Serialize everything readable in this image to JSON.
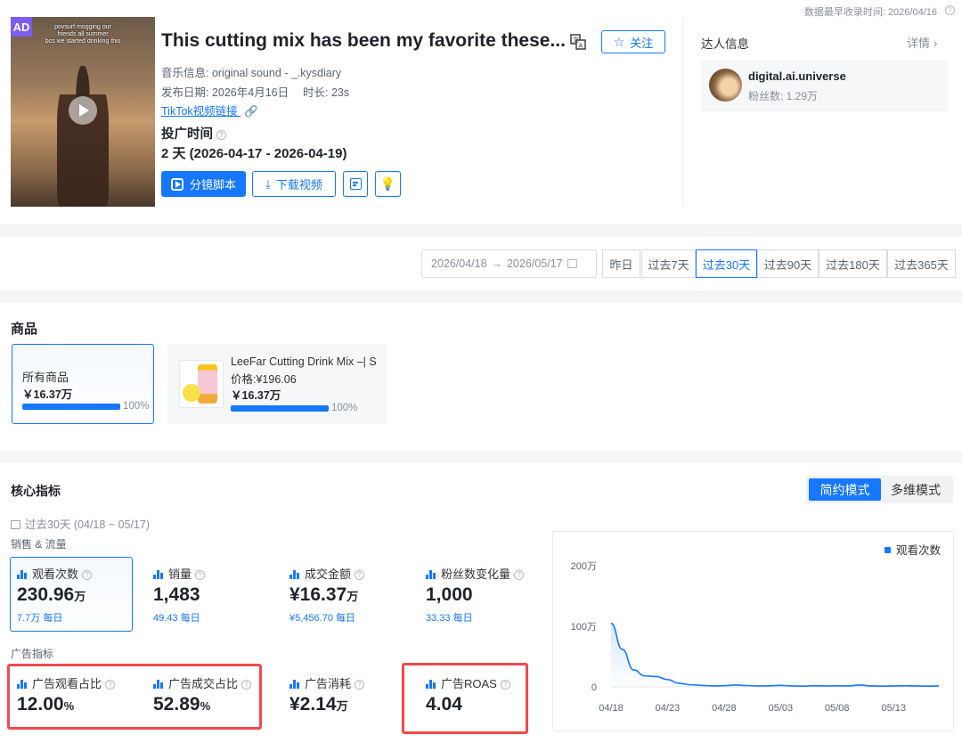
{
  "header": {
    "data_collected": "数据最早收录时间: 2026/04/16",
    "video": {
      "ad_badge": "AD",
      "caption_line1": "povsurf mogging our",
      "caption_line2": "friends all summer",
      "caption_line3": "bcs we started drinking this",
      "title": "This cutting mix has been my favorite these...",
      "follow_label": "关注",
      "music": "音乐信息: original sound - _.kysdiary",
      "publish_date": "发布日期: 2026年4月16日",
      "duration": "时长: 23s",
      "link": "TikTok视频链接",
      "ad_time_label": "投广时间",
      "ad_time_value": "2 天 (2026-04-17 - 2026-04-19)",
      "script_button": "分镜脚本",
      "download_button": "下载视频"
    },
    "influencer": {
      "section_title": "达人信息",
      "detail_link": "详情",
      "name": "digital.ai.universe",
      "fans": "粉丝数: 1.29万"
    }
  },
  "date_filter": {
    "start": "2026/04/18",
    "end": "2026/05/17",
    "ranges": [
      "昨日",
      "过去7天",
      "过去30天",
      "过去90天",
      "过去180天",
      "过去365天"
    ],
    "active_index": 2
  },
  "products": {
    "section_title": "商品",
    "all": {
      "label": "所有商品",
      "amount": "￥16.37万",
      "percent": "100%",
      "fill": 1.0
    },
    "item": {
      "name": "LeeFar Cutting Drink Mix –| S",
      "price": "价格:¥196.06",
      "amount": "￥16.37万",
      "percent": "100%",
      "fill": 1.0
    }
  },
  "core": {
    "section_title": "核心指标",
    "modes": [
      "简约模式",
      "多维模式"
    ],
    "period": "过去30天 (04/18 ~ 05/17)",
    "sales_group": "销售 & 流量",
    "ads_group": "广告指标",
    "metrics": [
      {
        "label": "观看次数",
        "value": "230.96",
        "unit": "万",
        "sub": "7.7万 每日"
      },
      {
        "label": "销量",
        "value": "1,483",
        "unit": "",
        "sub": "49.43 每日"
      },
      {
        "label": "成交金额",
        "value": "¥16.37",
        "unit": "万",
        "sub": "¥5,456.70 每日"
      },
      {
        "label": "粉丝数变化量",
        "value": "1,000",
        "unit": "",
        "sub": "33.33 每日"
      }
    ],
    "ad_metrics": [
      {
        "label": "广告观看占比",
        "value": "12.00",
        "unit": "%"
      },
      {
        "label": "广告成交占比",
        "value": "52.89",
        "unit": "%"
      },
      {
        "label": "广告消耗",
        "value": "¥2.14",
        "unit": "万"
      },
      {
        "label": "广告ROAS",
        "value": "4.04",
        "unit": ""
      }
    ]
  },
  "chart_data": {
    "type": "area",
    "series": [
      {
        "name": "观看次数",
        "values": [
          1050000,
          620000,
          280000,
          180000,
          170000,
          120000,
          60000,
          35000,
          25000,
          15000,
          20000,
          30000,
          22000,
          15000,
          18000,
          25000,
          15000,
          12000,
          20000,
          15000,
          18000,
          15000,
          30000,
          15000,
          12000,
          15000,
          20000,
          15000,
          12000,
          15000
        ]
      }
    ],
    "x_tick_labels": [
      "04/18",
      "04/23",
      "04/28",
      "05/03",
      "05/08",
      "05/13"
    ],
    "y_tick_labels": [
      "0",
      "100万",
      "200万"
    ],
    "ylim": [
      0,
      2000000
    ],
    "legend": "top-right",
    "color": "#1677ff"
  }
}
